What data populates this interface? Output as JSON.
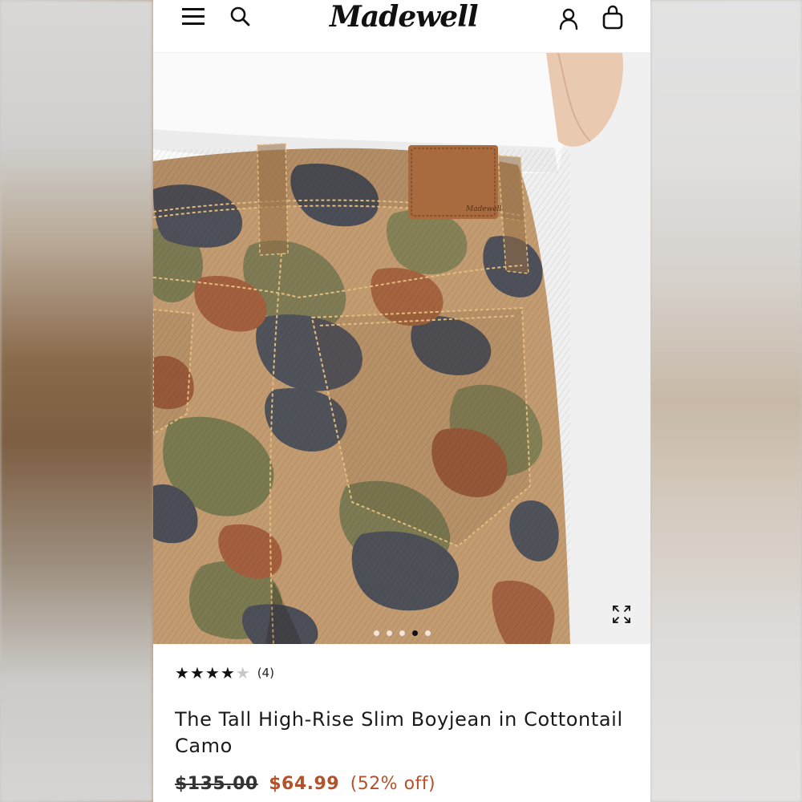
{
  "header": {
    "brand": "Madewell",
    "menu_icon": "hamburger-menu-icon",
    "search_icon": "search-icon",
    "account_icon": "account-icon",
    "bag_icon": "shopping-bag-icon"
  },
  "gallery": {
    "expand_icon": "expand-icon",
    "image_count": 5,
    "active_index": 3,
    "patch_text": "Madewell"
  },
  "product": {
    "rating_value": 4,
    "rating_max": 5,
    "review_count": "(4)",
    "title": "The Tall High-Rise Slim Boyjean in Cottontail Camo",
    "original_price": "$135.00",
    "sale_price": "$64.99",
    "discount": "(52% off)"
  },
  "colors": {
    "sale": "#b5512a",
    "text": "#1a1a1a"
  }
}
